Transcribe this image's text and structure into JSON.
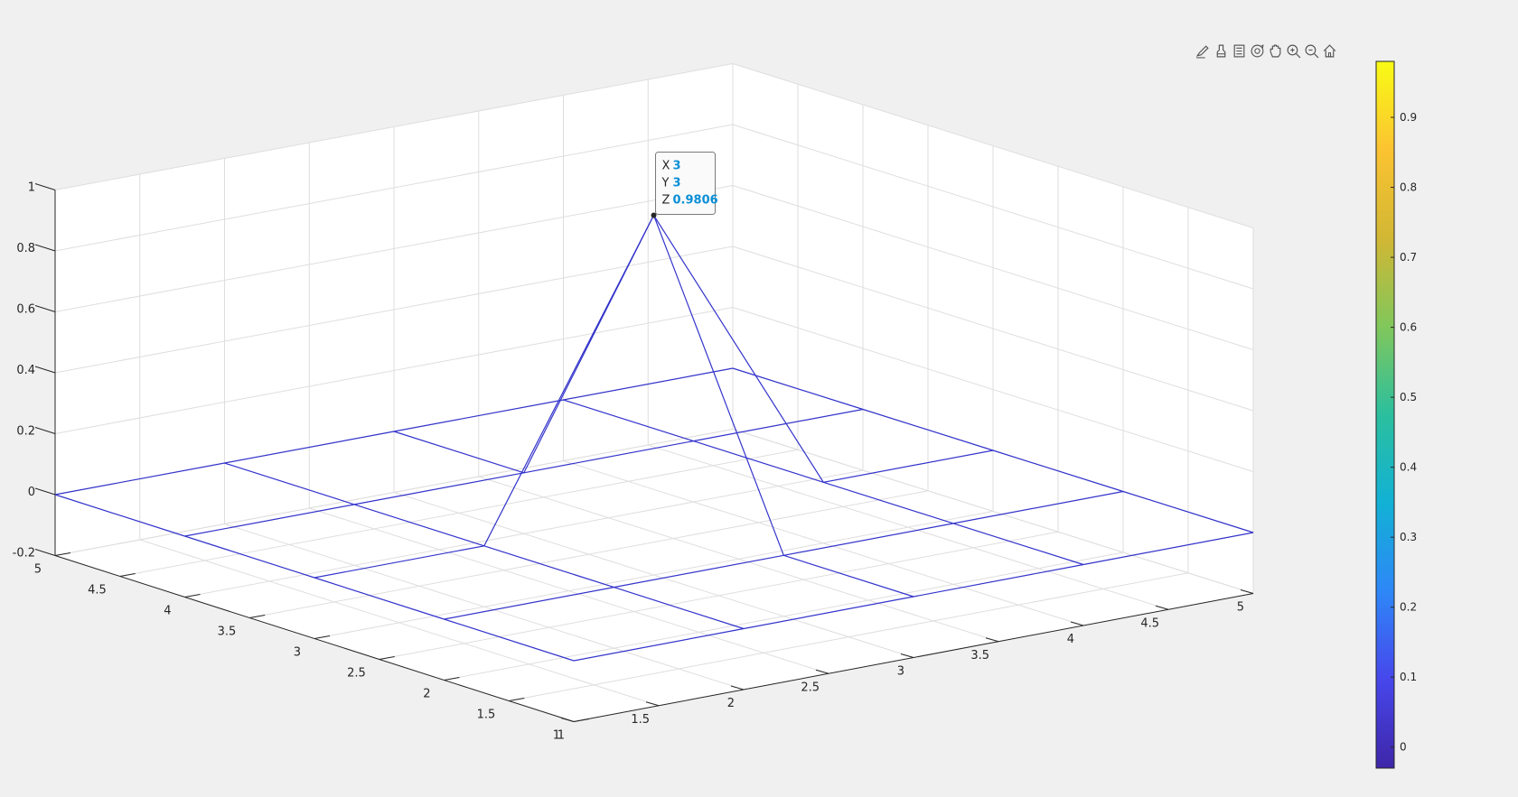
{
  "toolbar": {
    "buttons": [
      {
        "name": "brush-edit-icon"
      },
      {
        "name": "brush-data-icon"
      },
      {
        "name": "data-tips-icon"
      },
      {
        "name": "rotate-3d-icon"
      },
      {
        "name": "pan-icon"
      },
      {
        "name": "zoom-in-icon"
      },
      {
        "name": "zoom-out-icon"
      },
      {
        "name": "home-icon"
      }
    ]
  },
  "chart_data": {
    "type": "mesh",
    "title": "",
    "xlabel": "",
    "ylabel": "",
    "zlabel": "",
    "x": [
      1,
      2,
      3,
      4,
      5
    ],
    "y": [
      1,
      2,
      3,
      4,
      5
    ],
    "z": [
      [
        0,
        0,
        0,
        0,
        0
      ],
      [
        0,
        0,
        0,
        0,
        0
      ],
      [
        0,
        0,
        0.9806,
        0,
        0
      ],
      [
        0,
        0,
        0,
        0,
        0
      ],
      [
        0,
        0,
        0,
        0,
        0
      ]
    ],
    "xlim": [
      1,
      5
    ],
    "ylim": [
      1,
      5
    ],
    "zlim": [
      -0.2,
      1
    ],
    "x_ticks": [
      "1",
      "1.5",
      "2",
      "2.5",
      "3",
      "3.5",
      "4",
      "4.5",
      "5"
    ],
    "y_ticks": [
      "1",
      "1.5",
      "2",
      "2.5",
      "3",
      "3.5",
      "4",
      "4.5",
      "5"
    ],
    "z_ticks": [
      "-0.2",
      "0",
      "0.2",
      "0.4",
      "0.6",
      "0.8",
      "1"
    ],
    "grid": true,
    "line_color": "#3333cc",
    "colorbar": {
      "location": "right",
      "range": [
        -0.03,
        0.98
      ],
      "ticks": [
        "0",
        "0.1",
        "0.2",
        "0.3",
        "0.4",
        "0.5",
        "0.6",
        "0.7",
        "0.8",
        "0.9"
      ],
      "colormap": [
        "#3e26a8",
        "#4747eb",
        "#2e87f7",
        "#12b1d5",
        "#2bbf9e",
        "#81c75b",
        "#d2b734",
        "#fbc331",
        "#f9fb15"
      ]
    },
    "datatip": {
      "x_label": "X",
      "x_value": "3",
      "y_label": "Y",
      "y_value": "3",
      "z_label": "Z",
      "z_value": "0.9806"
    }
  }
}
